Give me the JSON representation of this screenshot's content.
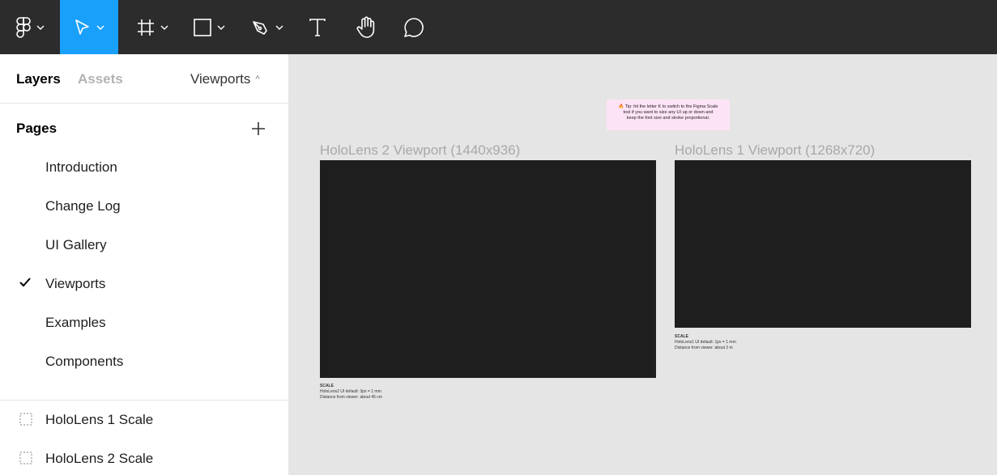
{
  "toolbar": {
    "tools": [
      {
        "name": "main-menu",
        "icon": "figma-logo-icon",
        "has_dropdown": true
      },
      {
        "name": "move-tool",
        "icon": "cursor-arrow-icon",
        "has_dropdown": true,
        "active": true
      },
      {
        "name": "frame-tool",
        "icon": "hash-frame-icon",
        "has_dropdown": true
      },
      {
        "name": "shape-tool",
        "icon": "rectangle-icon",
        "has_dropdown": true
      },
      {
        "name": "pen-tool",
        "icon": "pen-icon",
        "has_dropdown": true
      },
      {
        "name": "text-tool",
        "icon": "text-t-icon",
        "has_dropdown": false
      },
      {
        "name": "hand-tool",
        "icon": "hand-icon",
        "has_dropdown": false
      },
      {
        "name": "comment-tool",
        "icon": "speech-bubble-icon",
        "has_dropdown": false
      }
    ],
    "background": "#2c2c2c",
    "active_color": "#18a0fb"
  },
  "sidebar": {
    "tabs": {
      "layers": "Layers",
      "assets": "Assets",
      "current_page": "Viewports"
    },
    "pages_heading": "Pages",
    "pages": [
      {
        "label": "Introduction",
        "selected": false
      },
      {
        "label": "Change Log",
        "selected": false
      },
      {
        "label": "UI Gallery",
        "selected": false
      },
      {
        "label": "Viewports",
        "selected": true
      },
      {
        "label": "Examples",
        "selected": false
      },
      {
        "label": "Components",
        "selected": false
      }
    ],
    "layers": [
      {
        "label": "HoloLens 1 Scale",
        "icon": "dashed-frame-icon"
      },
      {
        "label": "HoloLens 2 Scale",
        "icon": "dashed-frame-icon"
      }
    ]
  },
  "canvas": {
    "tip": {
      "line1": "🔥 Tip: hit the letter K to switch to the Figma Scale",
      "line2": "tool if you want to size any UI up or down and",
      "line3": "keep the font size and stroke proportional.",
      "background": "#fce4f6"
    },
    "frames": [
      {
        "title": "HoloLens 2 Viewport (1440x936)",
        "scale_heading": "SCALE",
        "scale_line1": "HoloLens2 UI default: 3px = 1 mm",
        "scale_line2": "Distance from viewer: about 45 cm"
      },
      {
        "title": "HoloLens 1 Viewport (1268x720)",
        "scale_heading": "SCALE",
        "scale_line1": "HoloLens1 UI default: 1px = 1 mm",
        "scale_line2": "Distance from viewer: about 2 m"
      }
    ],
    "frame_color": "#1e1e1e"
  }
}
